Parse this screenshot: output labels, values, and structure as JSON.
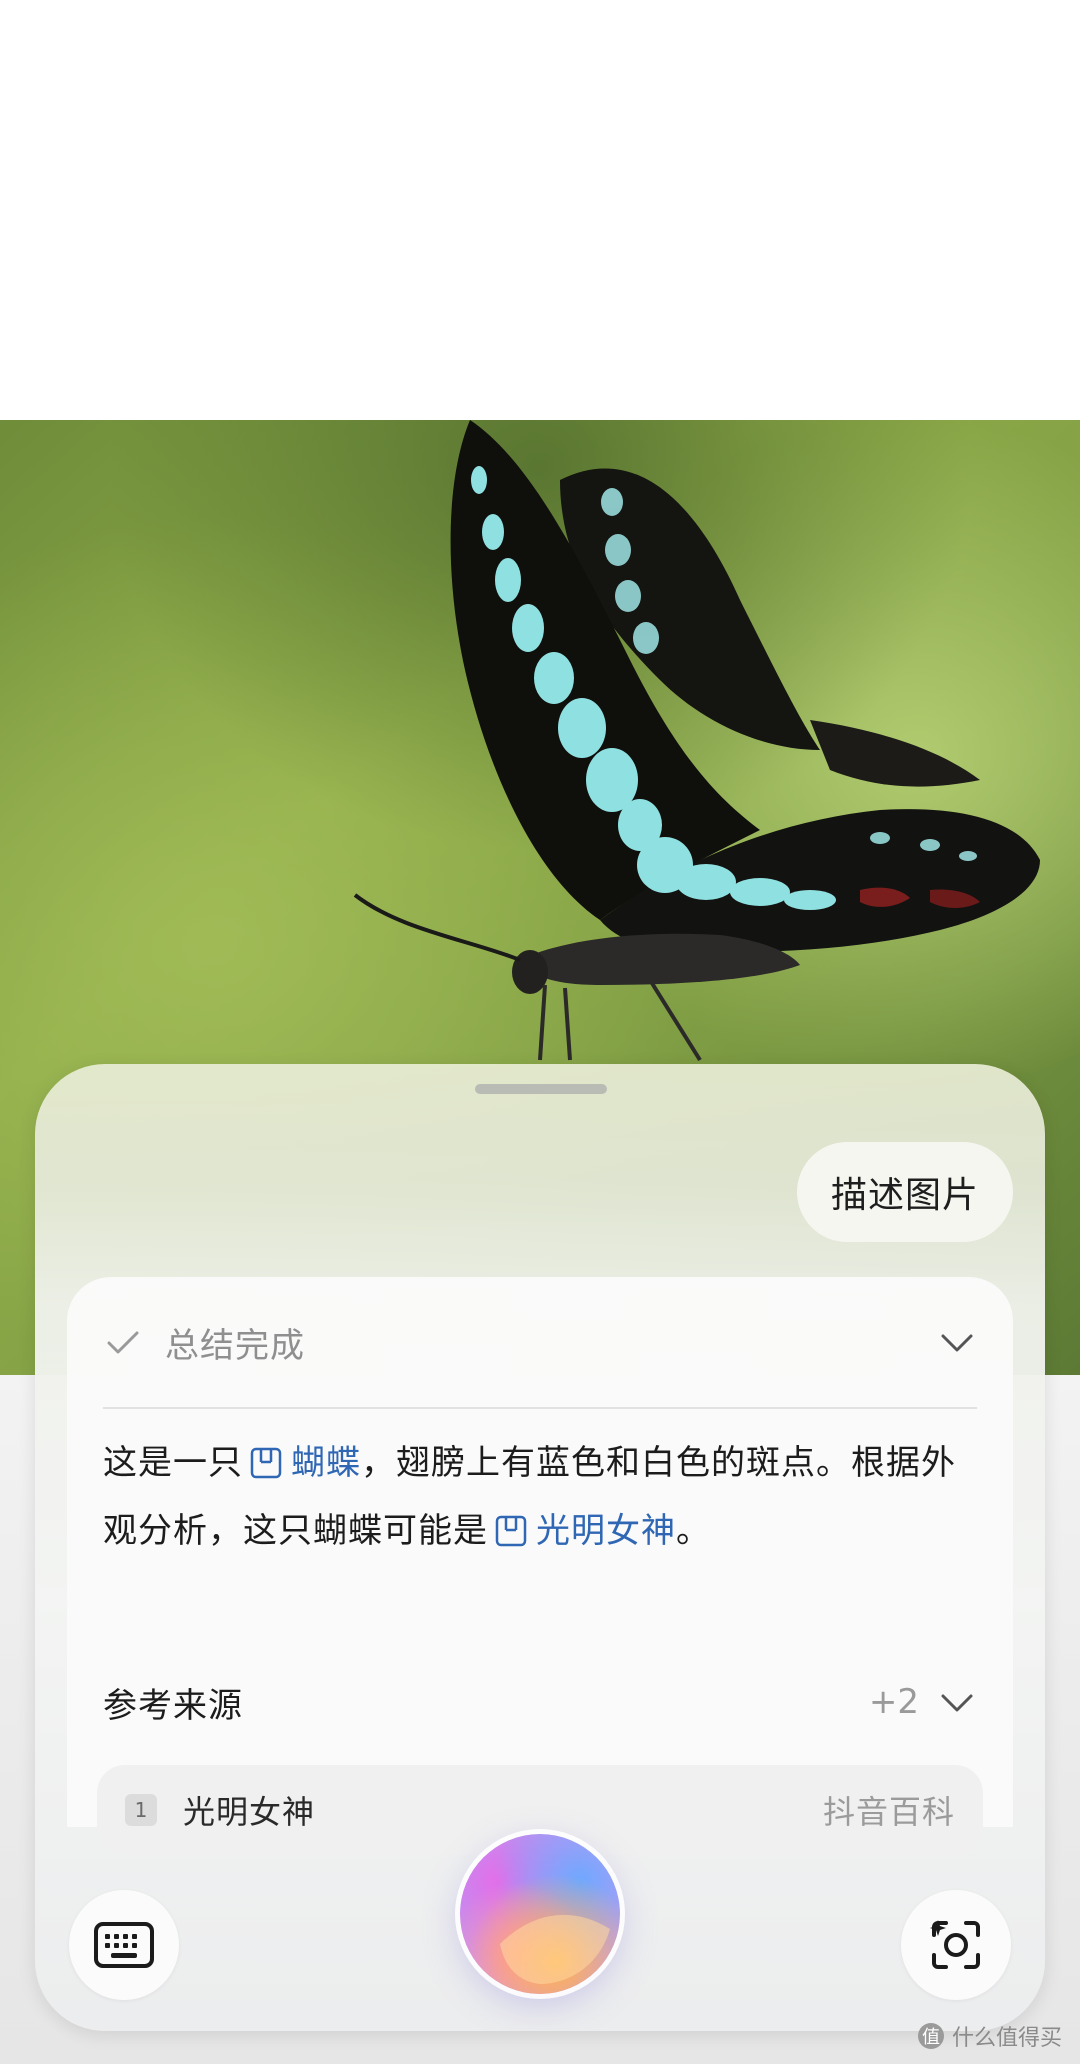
{
  "photo": {
    "subject": "butterfly-photo"
  },
  "panel": {
    "user_query": "描述图片",
    "status": {
      "label": "总结完成"
    },
    "answer": {
      "part1": "这是一只",
      "entity1": "蝴蝶",
      "part2": "，翅膀上有蓝色和白色的斑点。根据外观分析，这只蝴蝶可能是",
      "entity2": "光明女神",
      "part3": "。"
    },
    "references": {
      "title": "参考来源",
      "count": "+2",
      "items": [
        {
          "index": "1",
          "title": "光明女神",
          "source": "抖音百科"
        }
      ]
    },
    "bottom_bar": {
      "keyboard_icon": "keyboard-icon",
      "voice_icon": "voice-assistant-orb",
      "lens_icon": "visual-search-icon"
    }
  },
  "watermark": {
    "text": "什么值得买",
    "badge": "值"
  },
  "colors": {
    "link": "#2f67b4",
    "muted": "#8f8f8f",
    "text": "#1c1c1c"
  }
}
